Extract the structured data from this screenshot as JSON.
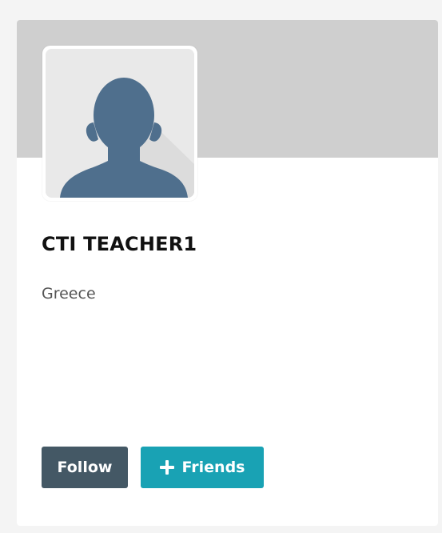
{
  "profile": {
    "name": "CTI TEACHER1",
    "location": "Greece"
  },
  "actions": {
    "follow_label": "Follow",
    "friends_label": "Friends"
  },
  "theme": {
    "background": "#f4f4f4",
    "card_background": "#ffffff",
    "cover_color": "#cfcfcf",
    "avatar_silhouette": "#4f6f8d",
    "follow_button": "#445865",
    "friends_button": "#19a2b4"
  },
  "icons": {
    "avatar": "user-silhouette-icon",
    "friends": "plus-icon"
  }
}
